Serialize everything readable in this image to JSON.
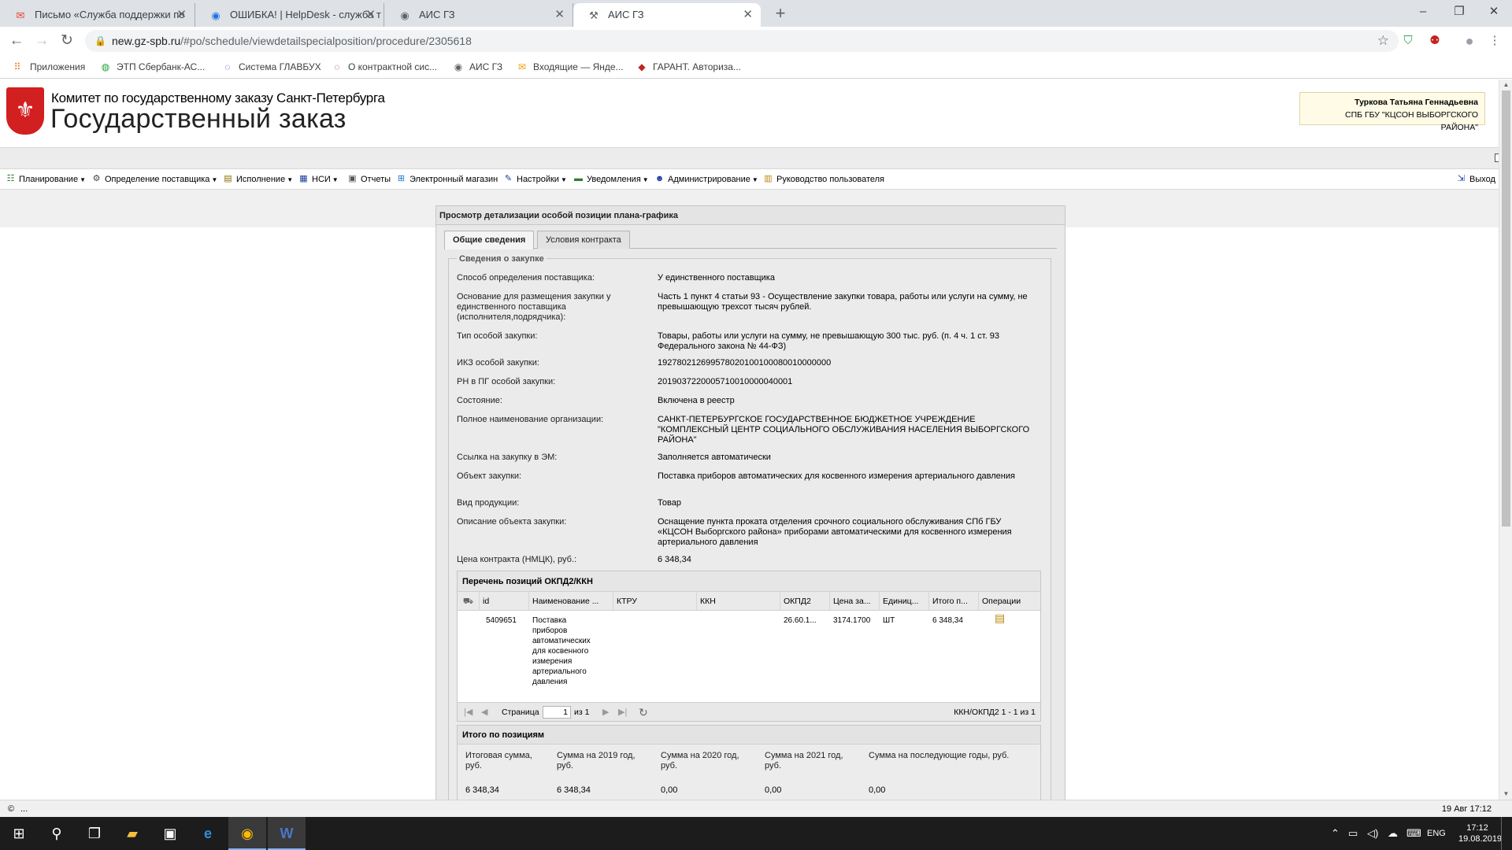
{
  "browser": {
    "tabs": [
      {
        "title": "Письмо «Служба поддержки по",
        "icon": "mail-icon"
      },
      {
        "title": "ОШИБКА! | HelpDesk - служба т",
        "icon": "globe-icon"
      },
      {
        "title": "АИС ГЗ",
        "icon": "globe-icon"
      },
      {
        "title": "АИС ГЗ",
        "icon": "tool-icon",
        "active": true
      }
    ],
    "url_host": "new.gz-spb.ru",
    "url_path": "/#po/schedule/viewdetailspecialposition/procedure/2305618",
    "bookmarks": [
      {
        "label": "Приложения"
      },
      {
        "label": "ЭТП Сбербанк-АС..."
      },
      {
        "label": "Система ГЛАВБУХ"
      },
      {
        "label": "О контрактной сис..."
      },
      {
        "label": "АИС ГЗ"
      },
      {
        "label": "Входящие — Янде..."
      },
      {
        "label": "ГАРАНТ. Авториза..."
      }
    ]
  },
  "header": {
    "org_subtitle": "Комитет по государственному заказу Санкт-Петербурга",
    "org_title": "Государственный заказ",
    "user_name": "Туркова Татьяна Геннадьевна",
    "user_org": "СПБ ГБУ \"КЦСОН ВЫБОРГСКОГО РАЙОНА\""
  },
  "menu": {
    "items": [
      {
        "label": "Планирование",
        "dropdown": true
      },
      {
        "label": "Определение поставщика",
        "dropdown": true
      },
      {
        "label": "Исполнение",
        "dropdown": true
      },
      {
        "label": "НСИ",
        "dropdown": true
      },
      {
        "label": "Отчеты",
        "dropdown": false
      },
      {
        "label": "Электронный магазин",
        "dropdown": false
      },
      {
        "label": "Настройки",
        "dropdown": true
      },
      {
        "label": "Уведомления",
        "dropdown": true
      },
      {
        "label": "Администрирование",
        "dropdown": true
      },
      {
        "label": "Руководство пользователя",
        "dropdown": false
      }
    ],
    "exit_label": "Выход"
  },
  "panel": {
    "title": "Просмотр детализации особой позиции плана-графика",
    "tabs": [
      {
        "label": "Общие сведения",
        "active": true
      },
      {
        "label": "Условия контракта",
        "active": false
      }
    ],
    "section_legend": "Сведения о закупке",
    "fields": [
      {
        "label": "Способ определения поставщика:",
        "value": "У единственного поставщика"
      },
      {
        "label": "Основание для размещения закупки у единственного поставщика (исполнителя,подрядчика):",
        "value": "Часть 1 пункт 4 статьи 93 - Осуществление закупки товара, работы или услуги на сумму, не превышающую трехсот тысяч рублей."
      },
      {
        "label": "Тип особой закупки:",
        "value": "Товары, работы или услуги на сумму, не превышающую 300 тыс. руб. (п. 4 ч. 1 ст. 93 Федерального закона № 44-ФЗ)"
      },
      {
        "label": "ИКЗ особой закупки:",
        "value": "192780212699578020100100080010000000"
      },
      {
        "label": "РН в ПГ особой закупки:",
        "value": "2019037220005710010000040001"
      },
      {
        "label": "Состояние:",
        "value": "Включена в реестр"
      },
      {
        "label": "Полное наименование организации:",
        "value": "САНКТ-ПЕТЕРБУРГСКОЕ ГОСУДАРСТВЕННОЕ БЮДЖЕТНОЕ УЧРЕЖДЕНИЕ \"КОМПЛЕКСНЫЙ ЦЕНТР СОЦИАЛЬНОГО ОБСЛУЖИВАНИЯ НАСЕЛЕНИЯ ВЫБОРГСКОГО РАЙОНА\""
      },
      {
        "label": "Ссылка на закупку в ЭМ:",
        "value": "Заполняется автоматически"
      },
      {
        "label": "Объект закупки:",
        "value": "Поставка приборов автоматических для косвенного измерения артериального давления"
      },
      {
        "label": "Вид продукции:",
        "value": "Товар"
      },
      {
        "label": "Описание объекта закупки:",
        "value": "Оснащение пункта проката отделения срочного социального обслуживания СПб ГБУ «КЦСОН Выборгского района» приборами автоматическими для косвенного измерения артериального давления"
      },
      {
        "label": "Цена контракта (НМЦК), руб.:",
        "value": "6 348,34"
      }
    ],
    "grid": {
      "title": "Перечень позиций ОКПД2/ККН",
      "columns": [
        "id",
        "Наименование ...",
        "КТРУ",
        "ККН",
        "ОКПД2",
        "Цена за...",
        "Единиц...",
        "Итого п...",
        "Операции"
      ],
      "rows": [
        {
          "id": "5409651",
          "name": "Поставка приборов автоматических для косвенного измерения артериального давления",
          "ktru": "",
          "kkn": "",
          "okpd2": "26.60.1...",
          "price": "3174.1700",
          "unit": "ШТ",
          "total": "6 348,34"
        }
      ],
      "pager": {
        "page_label": "Страница",
        "page": "1",
        "of_label": "из 1",
        "summary": "ККН/ОКПД2 1 - 1 из 1"
      }
    },
    "totals": {
      "title": "Итого по позициям",
      "columns": [
        {
          "label": "Итоговая сумма, руб.",
          "value": "6 348,34"
        },
        {
          "label": "Сумма на 2019 год, руб.",
          "value": "6 348,34"
        },
        {
          "label": "Сумма на 2020 год, руб.",
          "value": "0,00"
        },
        {
          "label": "Сумма на 2021 год, руб.",
          "value": "0,00"
        },
        {
          "label": "Сумма на последующие годы, руб.",
          "value": "0,00"
        }
      ]
    }
  },
  "statusbar": {
    "left": "...",
    "right": "19 Авг 17:12"
  },
  "taskbar": {
    "time": "17:12",
    "date": "19.08.2019",
    "lang": "ENG"
  }
}
